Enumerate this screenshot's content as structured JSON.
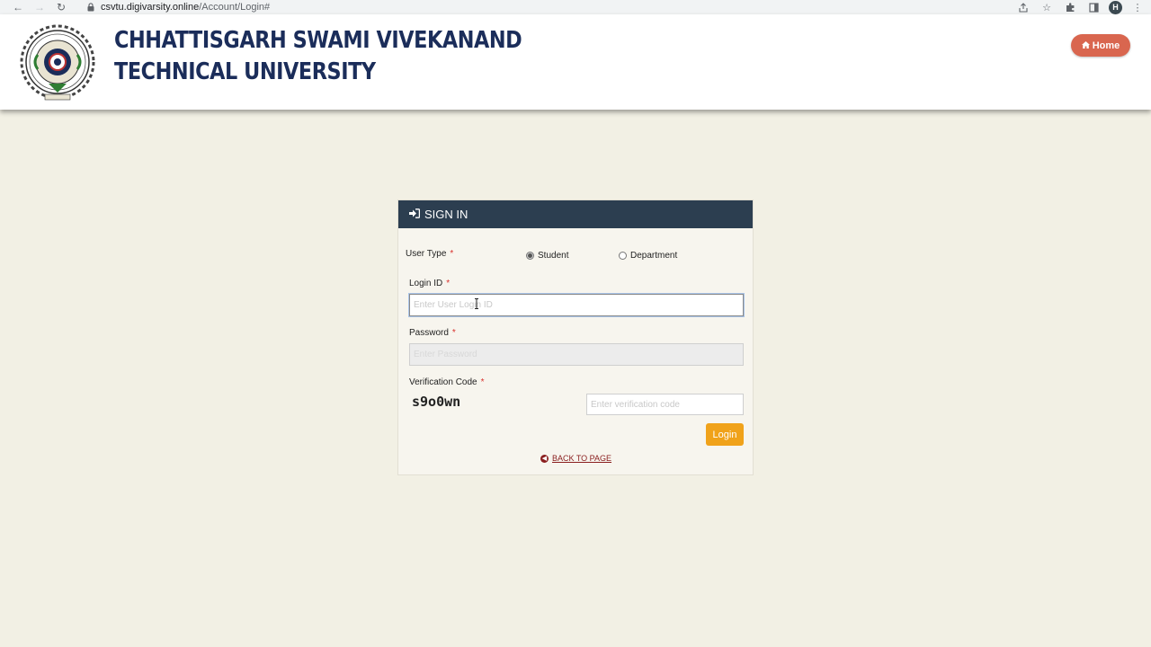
{
  "browser": {
    "url_host": "csvtu.digivarsity.online",
    "url_path": "/Account/Login#",
    "profile_initial": "H"
  },
  "header": {
    "title_line1": "CHHATTISGARH SWAMI VIVEKANAND",
    "title_line2": "TECHNICAL UNIVERSITY",
    "home_label": "Home"
  },
  "signin": {
    "title": "SIGN IN",
    "user_type_label": "User Type",
    "required_mark": "*",
    "options": [
      {
        "label": "Student",
        "selected": true
      },
      {
        "label": "Department",
        "selected": false
      }
    ],
    "login_id_label": "Login ID",
    "login_id_placeholder": "Enter User Login ID",
    "password_label": "Password",
    "password_placeholder": "Enter Password",
    "verification_label": "Verification Code",
    "captcha": "s9o0wn",
    "verification_placeholder": "Enter verification code",
    "login_button": "Login",
    "back_link": "BACK TO PAGE"
  },
  "colors": {
    "page_bg": "#f2f0e4",
    "title_color": "#1b2d5a",
    "card_header_bg": "#2c3e50",
    "home_button_bg": "#d9664f",
    "login_button_bg": "#f0a21a",
    "back_link_color": "#8a1e1e",
    "required_color": "#d9302c"
  }
}
